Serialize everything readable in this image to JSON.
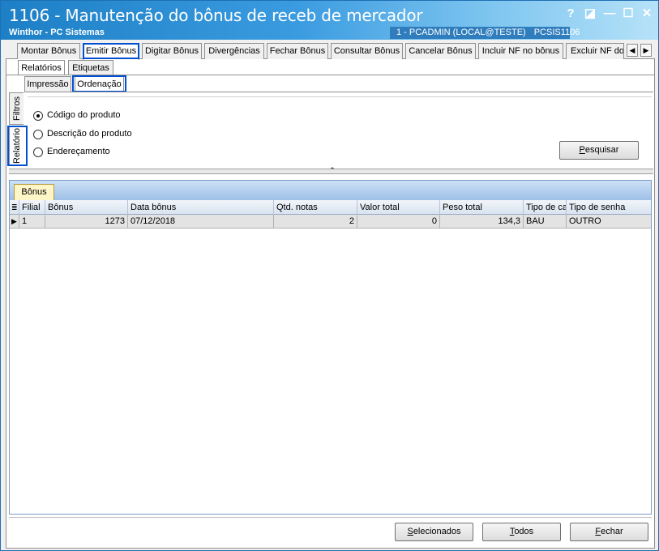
{
  "window": {
    "title": "1106 - Manutenção do bônus de receb de mercador",
    "subtitle": "Winthor - PC Sistemas",
    "user_info": "1 - PCADMIN (LOCAL@TESTE)",
    "program_code": "PCSIS1106",
    "help_glyph": "?",
    "restore_glyph": "◪",
    "minimize_glyph": "—",
    "maximize_glyph": "☐",
    "close_glyph": "✕"
  },
  "main_tabs": [
    {
      "label": "Montar Bônus"
    },
    {
      "label": "Emitir Bônus",
      "active": true
    },
    {
      "label": "Digitar Bônus"
    },
    {
      "label": "Divergências"
    },
    {
      "label": "Fechar Bônus"
    },
    {
      "label": "Consultar Bônus"
    },
    {
      "label": "Cancelar Bônus"
    },
    {
      "label": "Incluir NF no bônus"
    },
    {
      "label": "Excluir NF do b"
    }
  ],
  "tab_scroll": {
    "left": "◀",
    "right": "▶"
  },
  "sub_tabs": [
    {
      "label": "Relatórios",
      "active": true
    },
    {
      "label": "Etiquetas"
    }
  ],
  "inner_tabs": [
    {
      "label": "Impressão"
    },
    {
      "label": "Ordenação",
      "active": true
    }
  ],
  "side_tabs": [
    {
      "label": "Filtros"
    },
    {
      "label": "Relatório",
      "active": true
    }
  ],
  "ordering_options": [
    {
      "label": "Código do produto",
      "selected": true
    },
    {
      "label": "Descrição do produto",
      "selected": false
    },
    {
      "label": "Endereçamento",
      "selected": false
    }
  ],
  "buttons": {
    "search_pre": "",
    "search_key": "P",
    "search_post": "esquisar",
    "selected_pre": "",
    "selected_key": "S",
    "selected_post": "elecionados",
    "all_pre": "",
    "all_key": "T",
    "all_post": "odos",
    "close_pre": "",
    "close_key": "F",
    "close_post": "echar"
  },
  "splitter_glyph": "⌃",
  "grid": {
    "tab_label": "Bônus",
    "columns": [
      "Filial",
      "Bônus",
      "Data bônus",
      "Qtd. notas",
      "Valor total",
      "Peso total",
      "Tipo de ca",
      "Tipo de senha"
    ],
    "rows": [
      {
        "filial": "1",
        "bonus": "1273",
        "data": "07/12/2018",
        "qtd_notas": "2",
        "valor_total": "0",
        "peso_total": "134,3",
        "tipo_carga": "BAU",
        "tipo_senha": "OUTRO"
      }
    ]
  }
}
